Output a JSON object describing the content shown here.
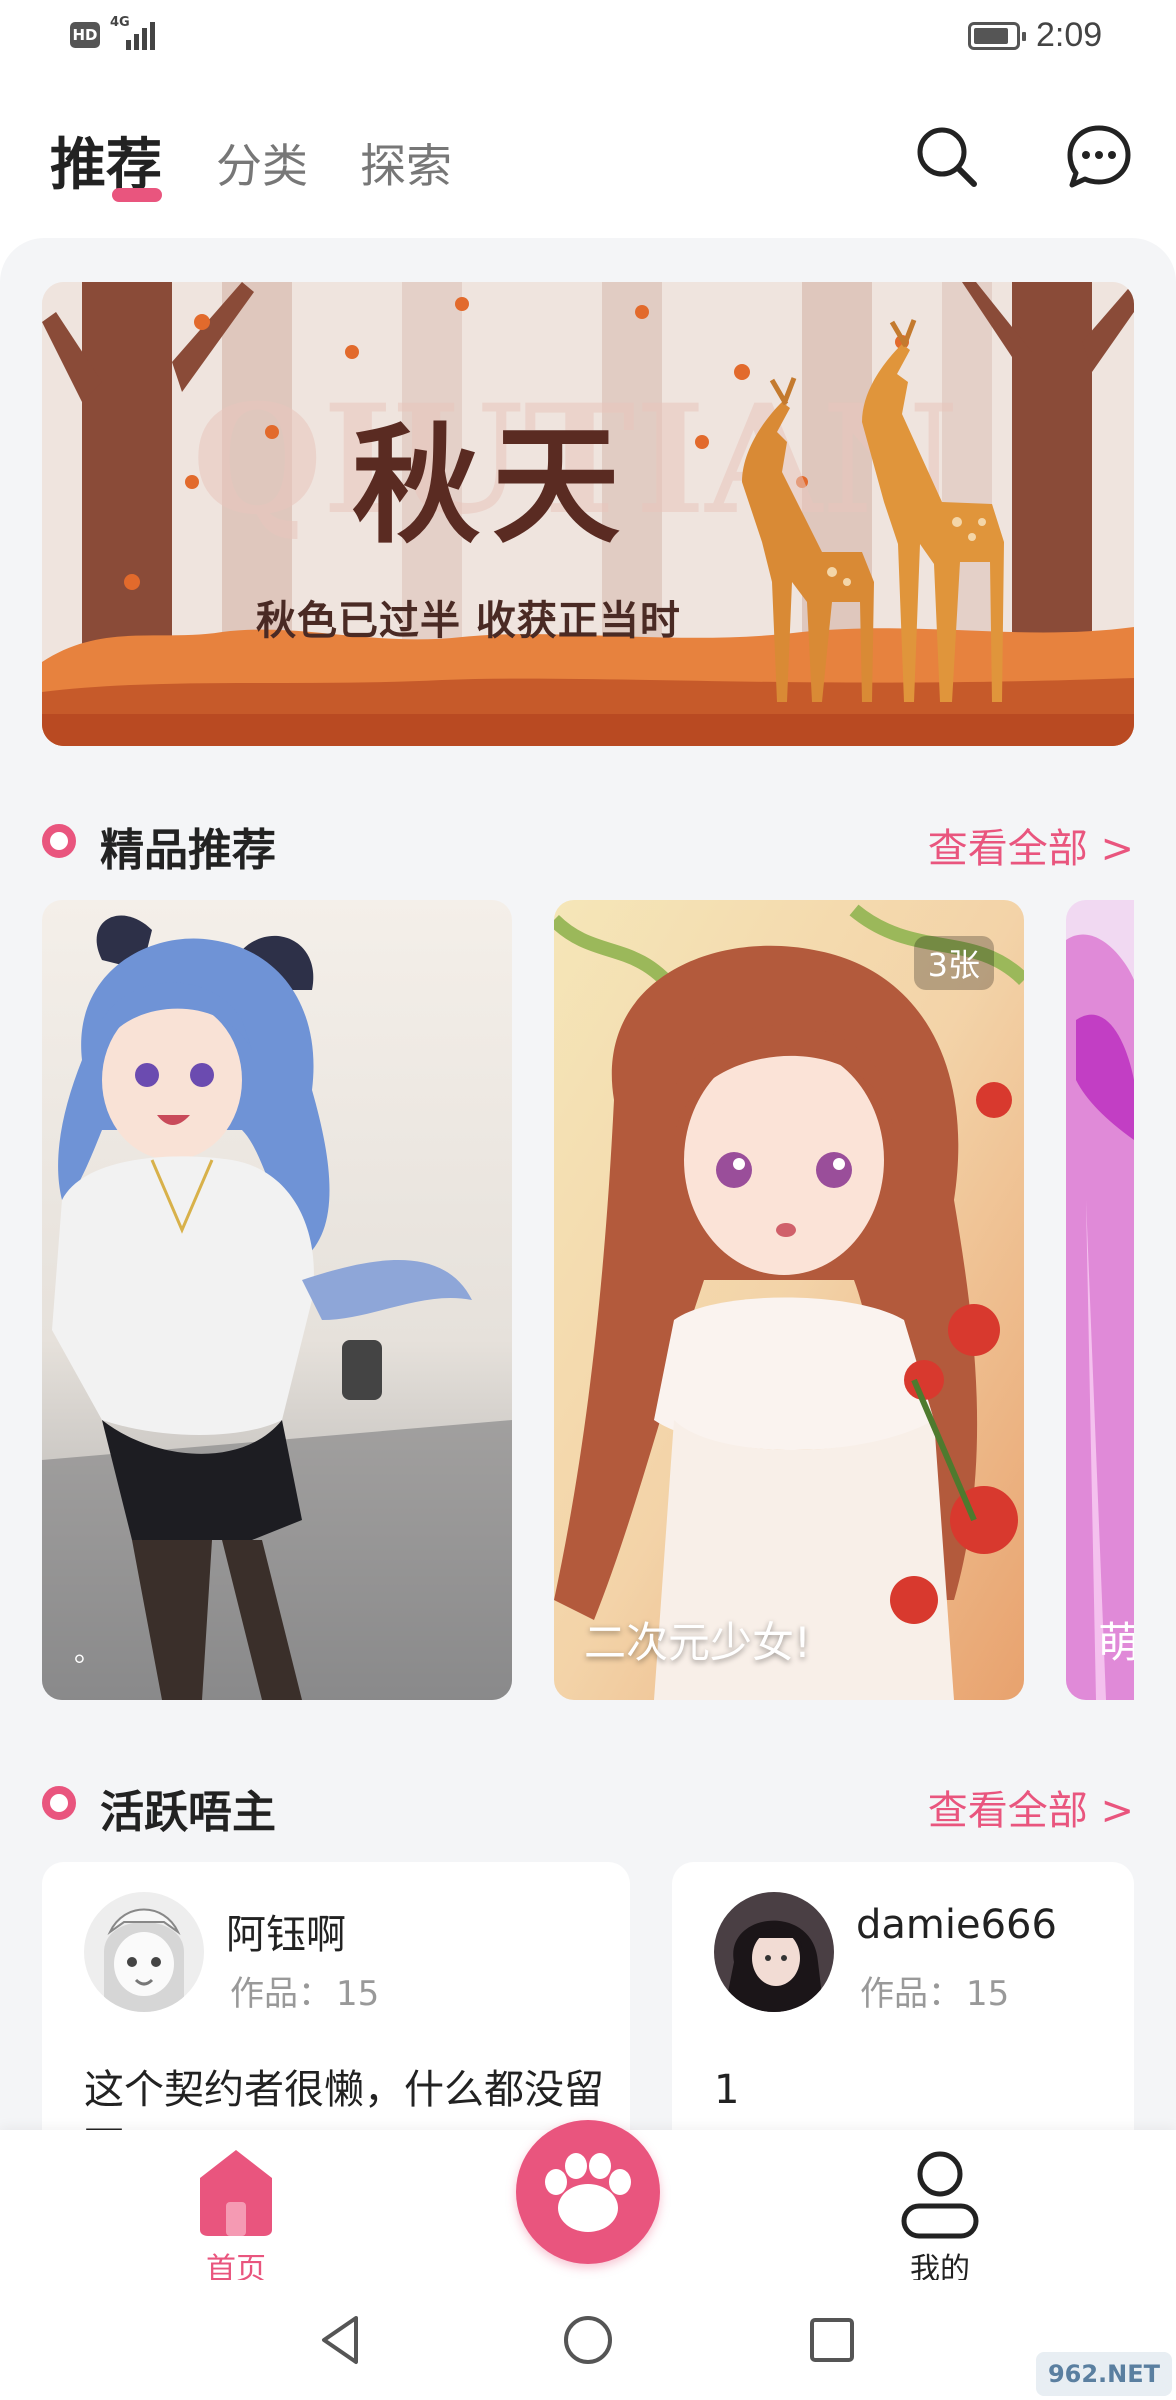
{
  "status_bar": {
    "hd": "HD",
    "network": "4G",
    "time": "2:09"
  },
  "nav": {
    "tabs": [
      {
        "label": "推荐",
        "active": true
      },
      {
        "label": "分类",
        "active": false
      },
      {
        "label": "探索",
        "active": false
      }
    ],
    "search_icon": "search-icon",
    "message_icon": "chat-bubble-icon"
  },
  "banner": {
    "title": "秋天",
    "subtitle": "秋色已过半 收获正当时",
    "watermark_text": "QIUTIAN"
  },
  "featured": {
    "title": "精品推荐",
    "more": "查看全部 >",
    "cards": [
      {
        "caption": "。",
        "count": ""
      },
      {
        "caption": "二次元少女!",
        "count": "3张"
      },
      {
        "caption": "萌",
        "count": ""
      }
    ]
  },
  "creators": {
    "title": "活跃唔主",
    "more": "查看全部 >",
    "works_label": "作品：",
    "items": [
      {
        "name": "阿钰啊",
        "works": "15",
        "bio": "这个契约者很懒，什么都没留下"
      },
      {
        "name": "damie666",
        "works": "15",
        "bio": "1"
      }
    ]
  },
  "tab_bar": {
    "home": "首页",
    "me": "我的",
    "center_icon": "paw-icon"
  },
  "watermark": "962.NET",
  "colors": {
    "accent": "#e9557e",
    "panel_bg": "#f4f5f7"
  }
}
